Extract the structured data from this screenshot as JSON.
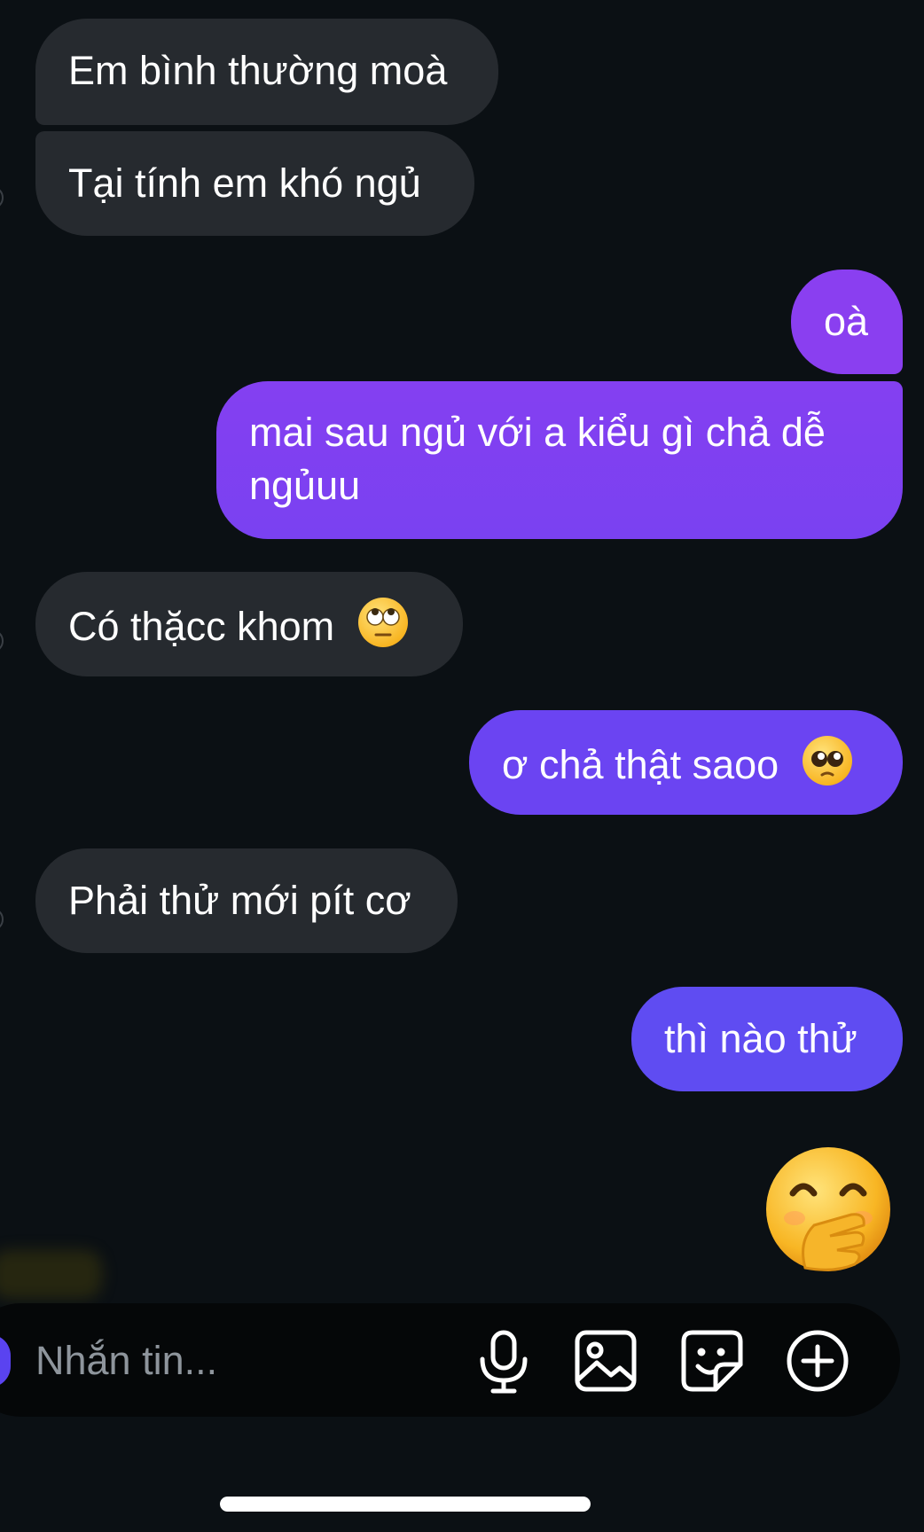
{
  "messages": [
    {
      "side": "received",
      "text": "Em bình thường moà"
    },
    {
      "side": "received",
      "text": "Tại tính em khó ngủ"
    },
    {
      "side": "sent",
      "text": "oà"
    },
    {
      "side": "sent",
      "text_line1": "mai sau ngủ với a kiểu gì chả dễ",
      "text_line2": "ngủuu"
    },
    {
      "side": "received",
      "text": "Có thặcc khom",
      "emoji": "face-with-rolling-eyes"
    },
    {
      "side": "sent",
      "text": "ơ chả thật saoo",
      "emoji": "pleading-face"
    },
    {
      "side": "received",
      "text": "Phải thử mới pít cơ"
    },
    {
      "side": "sent",
      "text": "thì nào thử"
    },
    {
      "side": "sent",
      "emoji": "face-with-hand-over-mouth"
    }
  ],
  "composer": {
    "placeholder": "Nhắn tin...",
    "tools": [
      "microphone-icon",
      "image-icon",
      "sticker-icon",
      "plus-circle-icon"
    ]
  },
  "colors": {
    "background": "#0b1014",
    "received_bubble": "#262a2f",
    "sent_top": "#8a3ff0",
    "sent_bottom": "#5f4cf2",
    "placeholder": "#8e959c"
  }
}
